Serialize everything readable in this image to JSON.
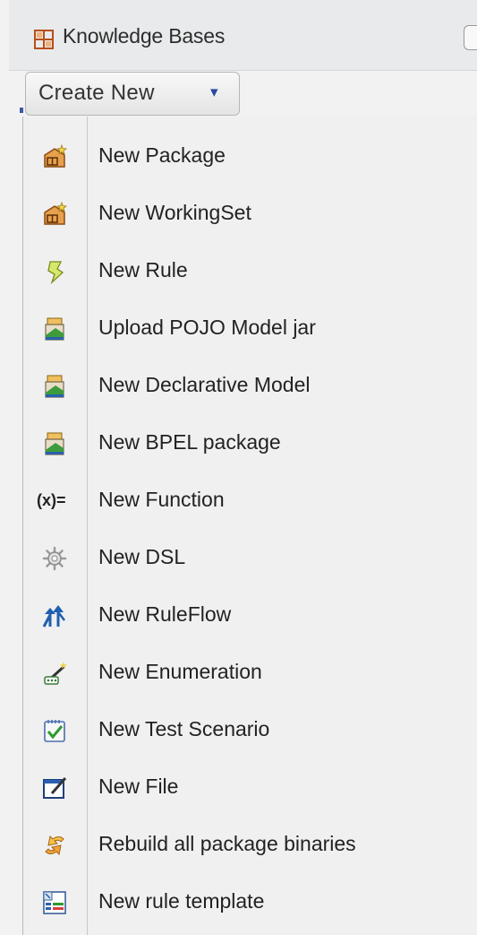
{
  "header": {
    "title": "Knowledge Bases",
    "icon": "grid-icon"
  },
  "toolbar": {
    "create_label": "Create New",
    "caret": "▾"
  },
  "menu": {
    "items": [
      {
        "label": "New Package",
        "icon": "package-icon"
      },
      {
        "label": "New WorkingSet",
        "icon": "package-icon"
      },
      {
        "label": "New Rule",
        "icon": "rule-icon"
      },
      {
        "label": "Upload POJO Model jar",
        "icon": "model-icon"
      },
      {
        "label": "New Declarative Model",
        "icon": "model-icon"
      },
      {
        "label": "New BPEL package",
        "icon": "model-icon"
      },
      {
        "label": "New Function",
        "icon": "function-icon",
        "glyph": "(x)="
      },
      {
        "label": "New DSL",
        "icon": "gear-icon"
      },
      {
        "label": "New RuleFlow",
        "icon": "ruleflow-icon"
      },
      {
        "label": "New Enumeration",
        "icon": "enumeration-icon"
      },
      {
        "label": "New Test Scenario",
        "icon": "test-scenario-icon"
      },
      {
        "label": "New File",
        "icon": "file-icon"
      },
      {
        "label": "Rebuild all package binaries",
        "icon": "rebuild-icon"
      },
      {
        "label": "New rule template",
        "icon": "template-icon"
      }
    ]
  },
  "colors": {
    "accent": "#2b4aa0",
    "header_bg": "#e9eaec",
    "menu_bg": "#f0f0f0"
  }
}
